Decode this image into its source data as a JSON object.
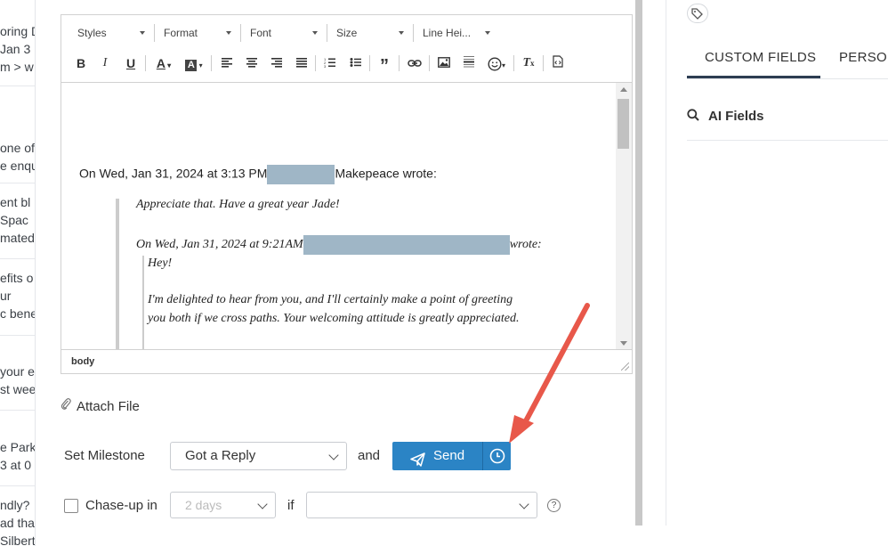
{
  "background_list": {
    "fragments": [
      {
        "text": "oring D"
      },
      {
        "text": "Jan 3"
      },
      {
        "text": "m > w"
      },
      {
        "text": "one of"
      },
      {
        "text": "e enqu"
      },
      {
        "text": "ent bl"
      },
      {
        "text": "Spac"
      },
      {
        "text": "mated"
      },
      {
        "text": "efits o"
      },
      {
        "text": "ur"
      },
      {
        "text": "c bene"
      },
      {
        "text": "your e"
      },
      {
        "text": "st wee"
      },
      {
        "text": "e Park"
      },
      {
        "text": "3 at 0"
      },
      {
        "text": "ndly?"
      },
      {
        "text": "ad tha"
      },
      {
        "text": "Silbert"
      }
    ]
  },
  "editor": {
    "combos": [
      "Styles",
      "Format",
      "Font",
      "Size",
      "Line Hei..."
    ],
    "toolbar_icons": [
      "bold-icon",
      "italic-icon",
      "underline-icon",
      "text-color-icon",
      "background-color-icon",
      "align-left-icon",
      "align-center-icon",
      "align-right-icon",
      "justify-icon",
      "numbered-list-icon",
      "bulleted-list-icon",
      "blockquote-icon",
      "link-icon",
      "image-icon",
      "horizontal-rule-icon",
      "emoji-icon",
      "remove-format-icon",
      "source-icon"
    ],
    "reply_header_pre": "On Wed, Jan 31, 2024 at 3:13 PM",
    "reply_header_post": "Makepeace wrote:",
    "quote1_line1": "Appreciate that. Have a great year Jade!",
    "quote1_line2_pre": "On Wed, Jan 31, 2024 at 9:21AM",
    "quote1_line2_post": "wrote:",
    "quote2_line1": "Hey!",
    "quote2_line2": "I'm delighted to hear from you, and I'll certainly make a point of greeting",
    "quote2_line3": "you both if we cross paths. Your welcoming attitude is greatly appreciated.",
    "status_path": "body"
  },
  "attach_label": "Attach File",
  "milestone": {
    "label": "Set Milestone",
    "selected": "Got a Reply",
    "and_label": "and",
    "send_label": "Send"
  },
  "chase_up": {
    "label": "Chase-up in",
    "days_selected": "2 days",
    "if_label": "if",
    "condition_selected": "",
    "help": "?"
  },
  "right_panel": {
    "tabs": [
      "CUSTOM FIELDS",
      "PERSON"
    ],
    "active_tab": "CUSTOM FIELDS",
    "ai_fields_label": "AI Fields"
  },
  "colors": {
    "send_button": "#2b84c5",
    "annotation_arrow": "#e8584a",
    "redaction": "#9fb6c6",
    "active_tab_underline": "#2d3d52"
  }
}
